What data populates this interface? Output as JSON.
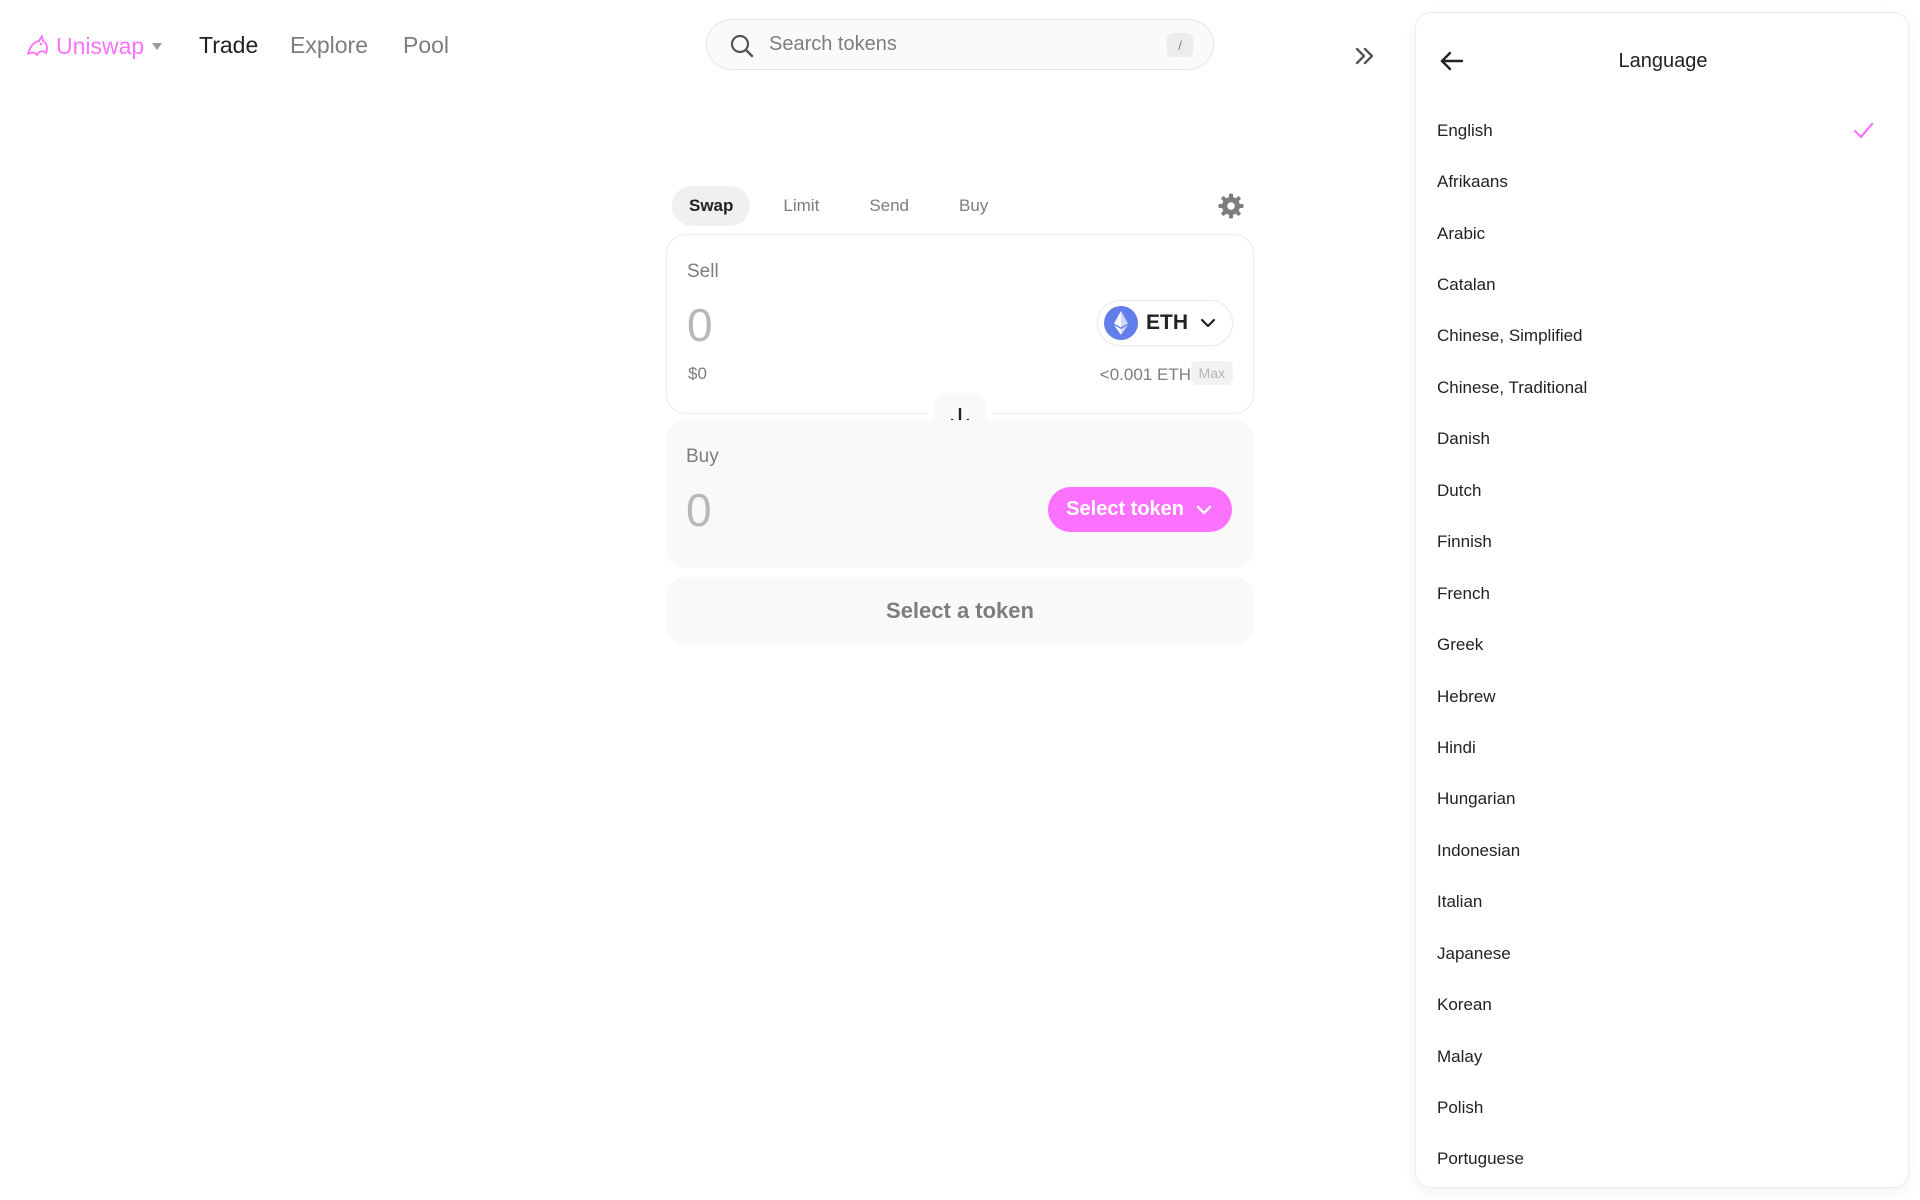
{
  "nav": {
    "brand": "Uniswap",
    "links": [
      "Trade",
      "Explore",
      "Pool"
    ],
    "active_link": "Trade"
  },
  "search": {
    "placeholder": "Search tokens",
    "shortcut": "/"
  },
  "swap": {
    "tabs": [
      "Swap",
      "Limit",
      "Send",
      "Buy"
    ],
    "active_tab": "Swap",
    "sell": {
      "label": "Sell",
      "amount_placeholder": "0",
      "usd_value": "$0",
      "token": "ETH",
      "balance": "<0.001 ETH",
      "max_label": "Max"
    },
    "buy": {
      "label": "Buy",
      "amount_placeholder": "0",
      "select_label": "Select token"
    },
    "action_label": "Select a token"
  },
  "language_panel": {
    "title": "Language",
    "selected": "English",
    "items": [
      "English",
      "Afrikaans",
      "Arabic",
      "Catalan",
      "Chinese, Simplified",
      "Chinese, Traditional",
      "Danish",
      "Dutch",
      "Finnish",
      "French",
      "Greek",
      "Hebrew",
      "Hindi",
      "Hungarian",
      "Indonesian",
      "Italian",
      "Japanese",
      "Korean",
      "Malay",
      "Polish",
      "Portuguese"
    ]
  },
  "colors": {
    "accent": "#fc72ff",
    "text_primary": "#222222",
    "text_secondary": "#7d7d7d",
    "surface": "#f9f9f9",
    "eth": "#627eea"
  },
  "icons": {
    "brand": "unicorn-logo-icon",
    "search": "search-icon",
    "collapse": "double-chevron-right-icon",
    "settings": "gear-icon",
    "token": "eth-icon",
    "dropdown": "chevron-down-icon",
    "switch": "arrow-down-icon",
    "back": "arrow-left-icon",
    "selected": "check-icon"
  }
}
